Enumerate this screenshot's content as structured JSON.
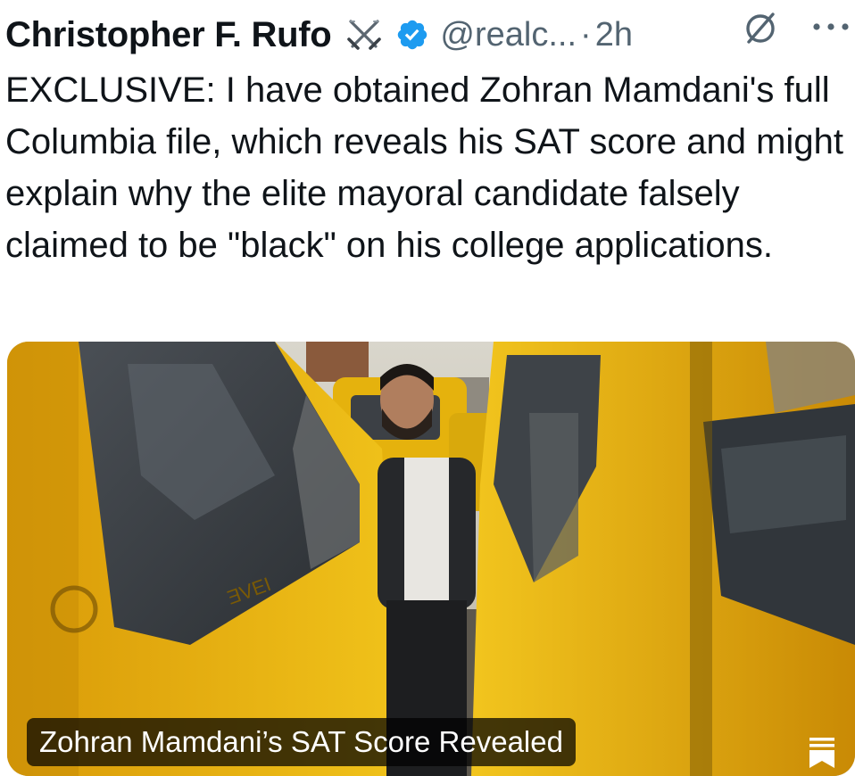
{
  "author": {
    "name": "Christopher F. Rufo",
    "handle": "@realc...",
    "separator": "·",
    "time": "2h"
  },
  "tweet": {
    "text": "EXCLUSIVE: I have obtained Zohran Mamdani's full Columbia file, which reveals his SAT score and might explain why the elite mayoral candidate falsely claimed to be \"black\" on his college applications."
  },
  "media": {
    "caption": "Zohran Mamdani’s SAT Score Revealed"
  },
  "icons": {
    "swords": "crossed-swords-icon",
    "verified": "verified-badge-icon",
    "grok": "grok-icon",
    "more": "more-options-icon",
    "reader": "article-reader-icon"
  },
  "colors": {
    "verified": "#1d9bf0",
    "secondary_text": "#536471",
    "primary_text": "#0f1419",
    "taxi_yellow": "#e8b90f"
  }
}
